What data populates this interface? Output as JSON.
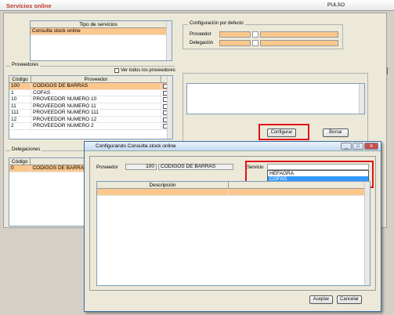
{
  "app": {
    "title": "Servicios online",
    "brand": "PULSO"
  },
  "services": {
    "header": "Tipo de servicios",
    "items": [
      "Consulta stock online"
    ]
  },
  "config": {
    "legend": "Configuración por defecto",
    "proveedor_label": "Proveedor",
    "delegacion_label": "Delegación"
  },
  "providers": {
    "legend": "Proveedores",
    "show_all": "Ver todos los proveedores",
    "col_code": "Código",
    "col_name": "Proveedor",
    "rows": [
      {
        "code": "100",
        "name": "CODIGOS DE BARRAS"
      },
      {
        "code": "1",
        "name": "COFAS"
      },
      {
        "code": "10",
        "name": "PROVEEDOR NUMERO 10"
      },
      {
        "code": "11",
        "name": "PROVEEDOR NUMERO 11"
      },
      {
        "code": "111",
        "name": "PROVEEDOR NUMERO 111"
      },
      {
        "code": "12",
        "name": "PROVEEDOR NUMERO 12"
      },
      {
        "code": "2",
        "name": "PROVEEDOR NUMERO 2"
      }
    ]
  },
  "delegations": {
    "legend": "Delegaciones",
    "col_code": "Código",
    "rows": [
      {
        "code": "0",
        "name": "CODIGOS DE BARRAS"
      }
    ]
  },
  "buttons": {
    "configurar": "Configurar",
    "borrar": "Borrar"
  },
  "dialog": {
    "title": "Configurando Consulta stock online",
    "proveedor_label": "Proveedor",
    "proveedor_code": "100",
    "proveedor_name": "CODIGOS DE BARRAS",
    "servicio_label": "Servicio",
    "options": [
      "HEFAGRA",
      "COFAS"
    ],
    "col_desc": "Descripción",
    "aceptar": "Aceptar",
    "cancelar": "Cancelar"
  },
  "colors": {
    "accent": "#fbc78d",
    "highlight": "#e0101a",
    "title": "#c0392b"
  }
}
